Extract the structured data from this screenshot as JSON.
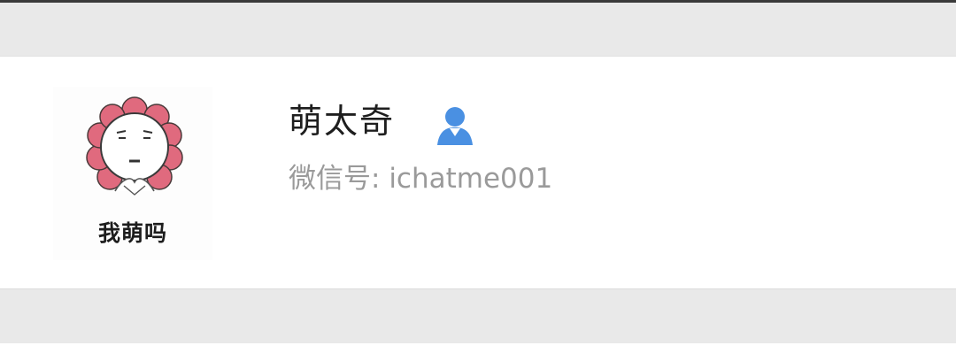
{
  "profile": {
    "name": "萌太奇",
    "wechat_id_label": "微信号:",
    "wechat_id_value": "ichatme001",
    "avatar_caption": "我萌吗",
    "icon": "contact-person-icon"
  },
  "colors": {
    "background": "#e9e9e9",
    "card": "#ffffff",
    "name_text": "#1e1e1e",
    "secondary_text": "#9a9a9a",
    "icon_blue": "#4a90e2",
    "avatar_petal": "#e06a7e"
  }
}
